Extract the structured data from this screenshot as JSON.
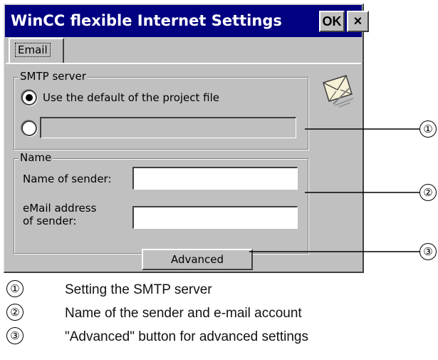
{
  "window": {
    "title": "WinCC flexible Internet Settings",
    "ok_label": "OK",
    "close_label": "×"
  },
  "tabs": [
    {
      "label": "Email",
      "active": true
    }
  ],
  "smtp": {
    "group_label": "SMTP server",
    "option_default_label": "Use the default of the project file",
    "option_default_selected": true,
    "option_custom_selected": false,
    "custom_value": ""
  },
  "name": {
    "group_label": "Name",
    "sender_label": "Name of sender:",
    "sender_value": "",
    "email_label_line1": "eMail address",
    "email_label_line2": "of sender:",
    "email_value": ""
  },
  "advanced_button_label": "Advanced",
  "icon": "mail-settings-icon",
  "markers": [
    "①",
    "②",
    "③"
  ],
  "legend": [
    {
      "num": "①",
      "text": "Setting the SMTP server"
    },
    {
      "num": "②",
      "text": "Name of the sender and e-mail account"
    },
    {
      "num": "③",
      "text": "\"Advanced\" button for advanced settings"
    }
  ],
  "colors": {
    "titlebar": "#000080",
    "dialog_face": "#c0c0c0"
  }
}
